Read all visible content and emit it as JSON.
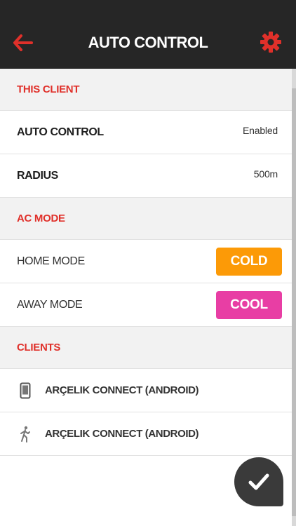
{
  "header": {
    "title": "AUTO CONTROL",
    "back_icon": "arrow-left-icon",
    "settings_icon": "gear-icon",
    "accent": "#e0302a",
    "background": "#262626"
  },
  "this_client": {
    "section_title": "THIS CLIENT",
    "auto_control": {
      "label": "AUTO CONTROL",
      "value": "Enabled"
    },
    "radius": {
      "label": "RADIUS",
      "value": "500m"
    }
  },
  "ac_mode": {
    "section_title": "AC MODE",
    "home": {
      "label": "HOME MODE",
      "mode": "COLD",
      "color": "#fc9a07"
    },
    "away": {
      "label": "AWAY MODE",
      "mode": "COOL",
      "color": "#e83ea4"
    }
  },
  "clients": {
    "section_title": "CLIENTS",
    "items": [
      {
        "name": "ARÇELIK CONNECT (ANDROID)",
        "icon": "phone-icon"
      },
      {
        "name": "ARÇELIK CONNECT (ANDROID)",
        "icon": "walking-person-icon"
      }
    ]
  },
  "confirm_icon": "checkmark-icon"
}
